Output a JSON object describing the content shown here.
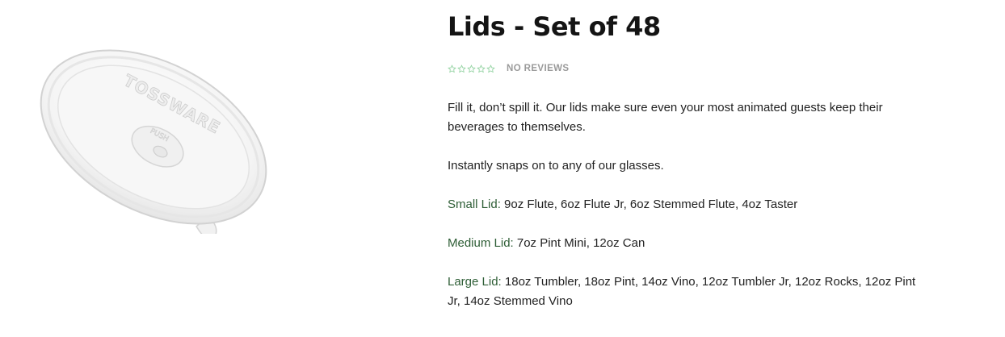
{
  "product": {
    "title": "Lids - Set of 48",
    "image_alt": "TOSSWARE clear lid with PUSH tab",
    "reviews_text": "NO REVIEWS",
    "rating": 0,
    "rating_max": 5,
    "description_1": "Fill it, don’t spill it. Our lids make sure even your most animated guests keep their beverages to themselves.",
    "description_2": "Instantly snaps on to any of our glasses.",
    "lids": [
      {
        "label": "Small Lid:",
        "fits": " 9oz Flute, 6oz Flute Jr, 6oz Stemmed Flute, 4oz Taster"
      },
      {
        "label": "Medium Lid:",
        "fits": " 7oz Pint Mini, 12oz Can"
      },
      {
        "label": "Large Lid:",
        "fits": " 18oz Tumbler, 18oz Pint, 14oz Vino, 12oz Tumbler Jr, 12oz Rocks, 12oz Pint Jr, 14oz Stemmed Vino"
      }
    ],
    "image_text": {
      "brand": "TOSSWARE",
      "push": "PUSH"
    }
  },
  "colors": {
    "star_outline": "#8fd19e",
    "lid_label": "#2e5e36",
    "reviews": "#9a9a9a"
  }
}
